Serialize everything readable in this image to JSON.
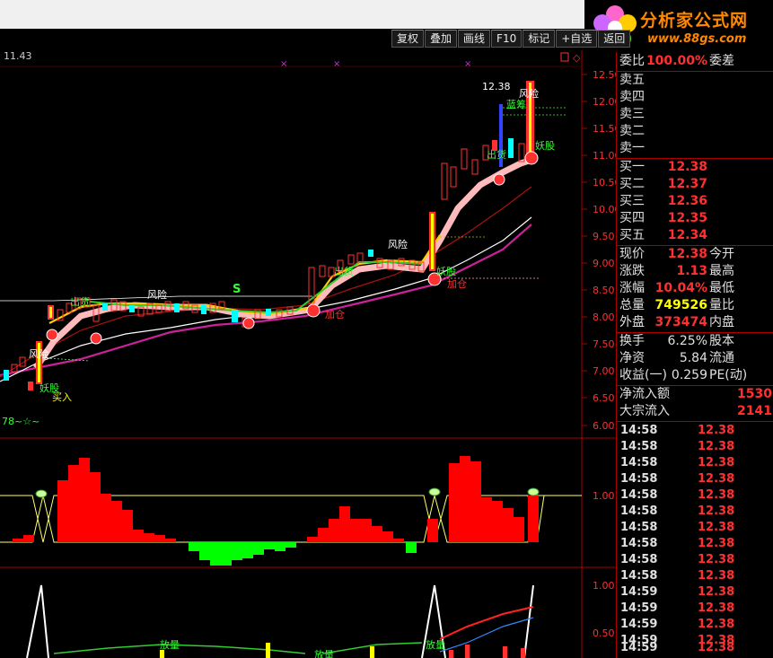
{
  "toolbar": {
    "buttons": [
      "复权",
      "叠加",
      "画线",
      "F10",
      "标记",
      "+自选",
      "返回"
    ]
  },
  "logo": {
    "title": "分析家公式网",
    "url": "www.88gs.com"
  },
  "chart": {
    "top_left_price": "11.43",
    "high_label": "12.38",
    "bottom_label": "78~☆~",
    "y_axis_main": [
      "12.50",
      "12.00",
      "11.50",
      "11.00",
      "10.50",
      "10.00",
      "9.50",
      "9.00",
      "8.50",
      "8.00",
      "7.50",
      "7.00",
      "6.50",
      "6.00"
    ],
    "y_axis_mid": [
      "1.00"
    ],
    "y_axis_low": [
      "1.00",
      "0.50"
    ],
    "annotations": {
      "chu": "出货",
      "risk": "风险",
      "buy": "买入",
      "yao": "妖股",
      "jiacang": "加仓",
      "s": "S",
      "lanchou": "蓝筹",
      "fangliang": "放量"
    }
  },
  "quote": {
    "weibi": {
      "label": "委比",
      "value": "100.00%",
      "right": "委差"
    },
    "sell": [
      {
        "label": "卖五"
      },
      {
        "label": "卖四"
      },
      {
        "label": "卖三"
      },
      {
        "label": "卖二"
      },
      {
        "label": "卖一"
      }
    ],
    "buy": [
      {
        "label": "买一",
        "price": "12.38"
      },
      {
        "label": "买二",
        "price": "12.37"
      },
      {
        "label": "买三",
        "price": "12.36"
      },
      {
        "label": "买四",
        "price": "12.35"
      },
      {
        "label": "买五",
        "price": "12.34"
      }
    ],
    "stats": [
      {
        "label": "现价",
        "value": "12.38",
        "right": "今开"
      },
      {
        "label": "涨跌",
        "value": "1.13",
        "right": "最高"
      },
      {
        "label": "涨幅",
        "value": "10.04%",
        "right": "最低"
      },
      {
        "label": "总量",
        "value": "749526",
        "right": "量比"
      },
      {
        "label": "外盘",
        "value": "373474",
        "right": "内盘"
      }
    ],
    "stats2": [
      {
        "label": "换手",
        "value": "6.25%",
        "right": "股本"
      },
      {
        "label": "净资",
        "value": "5.84",
        "right": "流通"
      },
      {
        "label": "收益(一)",
        "value": "0.259",
        "right": "PE(动)"
      }
    ],
    "flow": [
      {
        "label": "净流入额",
        "value": "1530"
      },
      {
        "label": "大宗流入",
        "value": "2141"
      }
    ],
    "ticks": [
      {
        "time": "14:58",
        "price": "12.38"
      },
      {
        "time": "14:58",
        "price": "12.38"
      },
      {
        "time": "14:58",
        "price": "12.38"
      },
      {
        "time": "14:58",
        "price": "12.38"
      },
      {
        "time": "14:58",
        "price": "12.38"
      },
      {
        "time": "14:58",
        "price": "12.38"
      },
      {
        "time": "14:58",
        "price": "12.38"
      },
      {
        "time": "14:58",
        "price": "12.38"
      },
      {
        "time": "14:58",
        "price": "12.38"
      },
      {
        "time": "14:58",
        "price": "12.38"
      },
      {
        "time": "14:59",
        "price": "12.38"
      },
      {
        "time": "14:59",
        "price": "12.38"
      },
      {
        "time": "14:59",
        "price": "12.38"
      },
      {
        "time": "14:59",
        "price": "12.38"
      },
      {
        "time": "14:59",
        "price": "12.38"
      }
    ]
  }
}
